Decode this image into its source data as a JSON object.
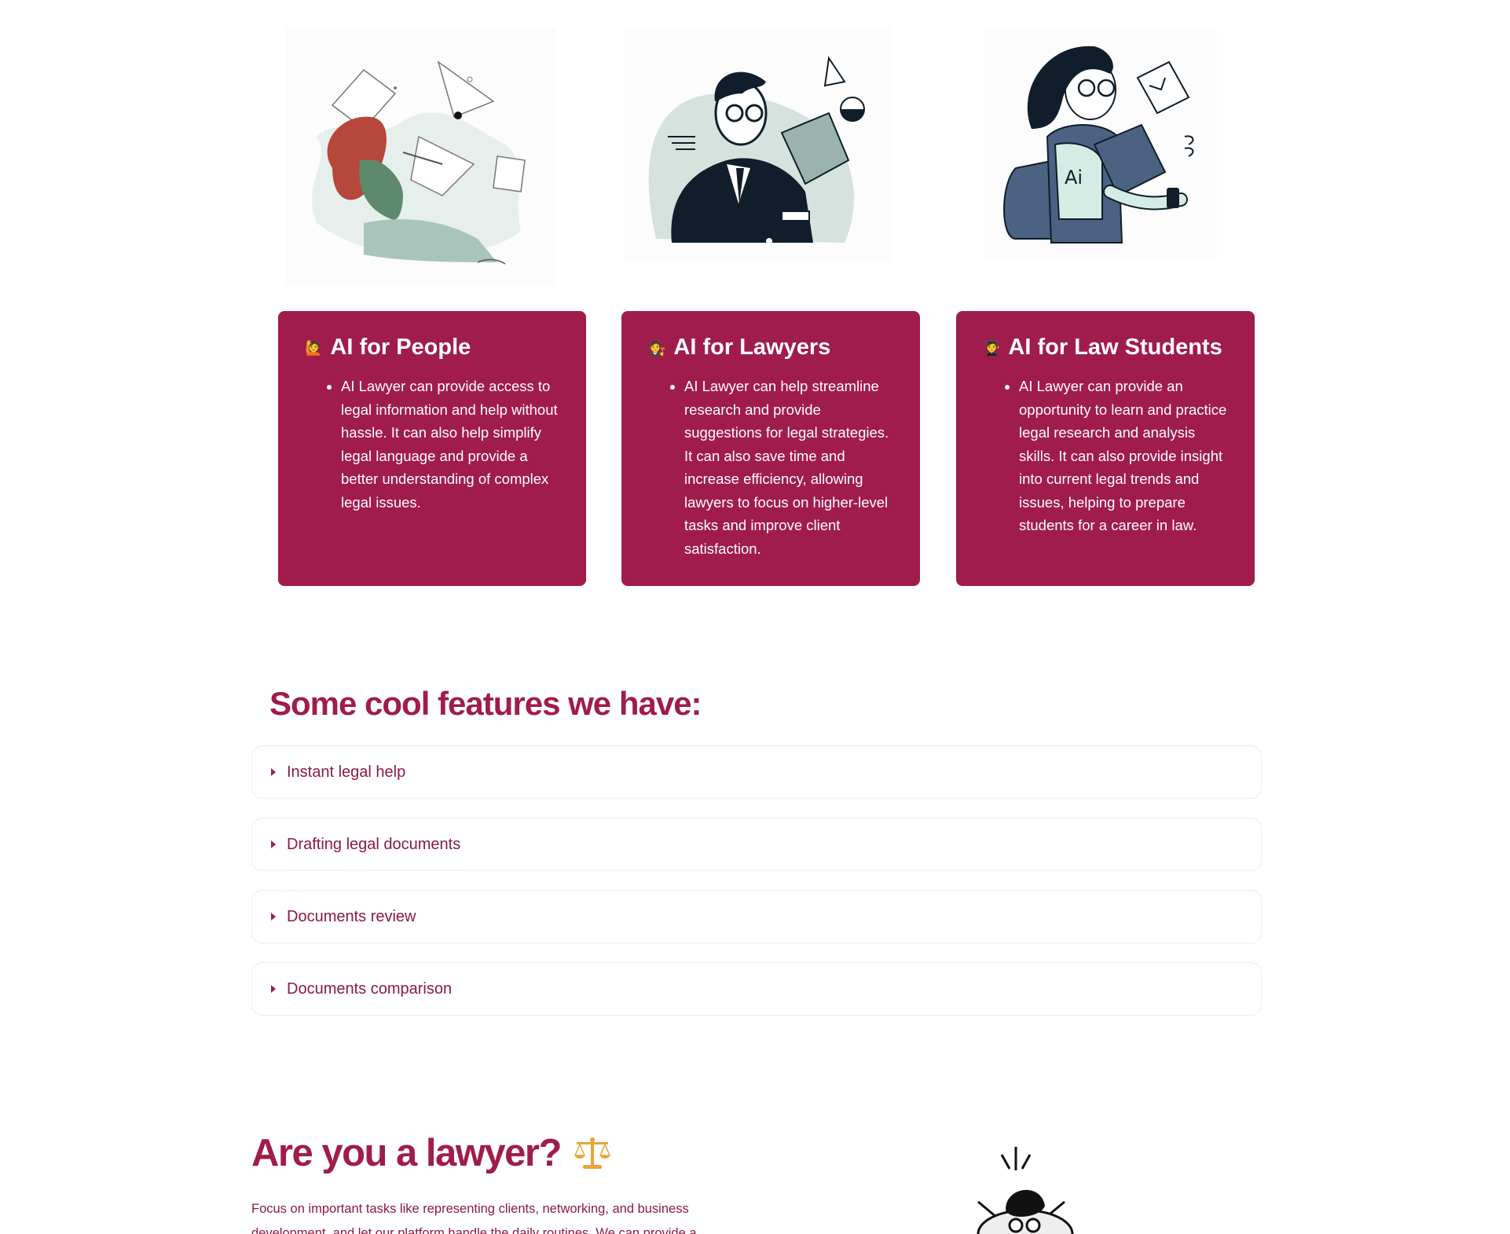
{
  "cards": [
    {
      "emoji": "🙋",
      "title": "AI for People",
      "text": "AI Lawyer can provide access to legal information and help without hassle. It can also help simplify legal language and provide a better understanding of complex legal issues."
    },
    {
      "emoji": "🧑‍⚖️",
      "title": "AI for Lawyers",
      "text": "AI Lawyer can help streamline research and provide suggestions for legal strategies. It can also save time and increase efficiency, allowing lawyers to focus on higher-level tasks and improve client satisfaction."
    },
    {
      "emoji": "🧑‍🎓",
      "title": "AI for Law Students",
      "text": "AI Lawyer can provide an opportunity to learn and practice legal research and analysis skills. It can also provide insight into current legal trends and issues, helping to prepare students for a career in law."
    }
  ],
  "features": {
    "title": "Some cool features we have:",
    "items": [
      "Instant legal help",
      "Drafting legal documents",
      "Documents review",
      "Documents comparison"
    ]
  },
  "lawyer_section": {
    "title": "Are you a lawyer?",
    "icon": "balance-scale-icon",
    "description": "Focus on important tasks like representing clients, networking, and business development, and let our platform handle the daily routines. We can provide a"
  },
  "colors": {
    "brand": "#a01c4c",
    "text_dark_brand": "#8b1a45",
    "illustration_teal": "#a9c4bb",
    "illustration_navy": "#0f1e2a",
    "illustration_blue": "#4b6282",
    "illustration_red": "#b5483a"
  }
}
